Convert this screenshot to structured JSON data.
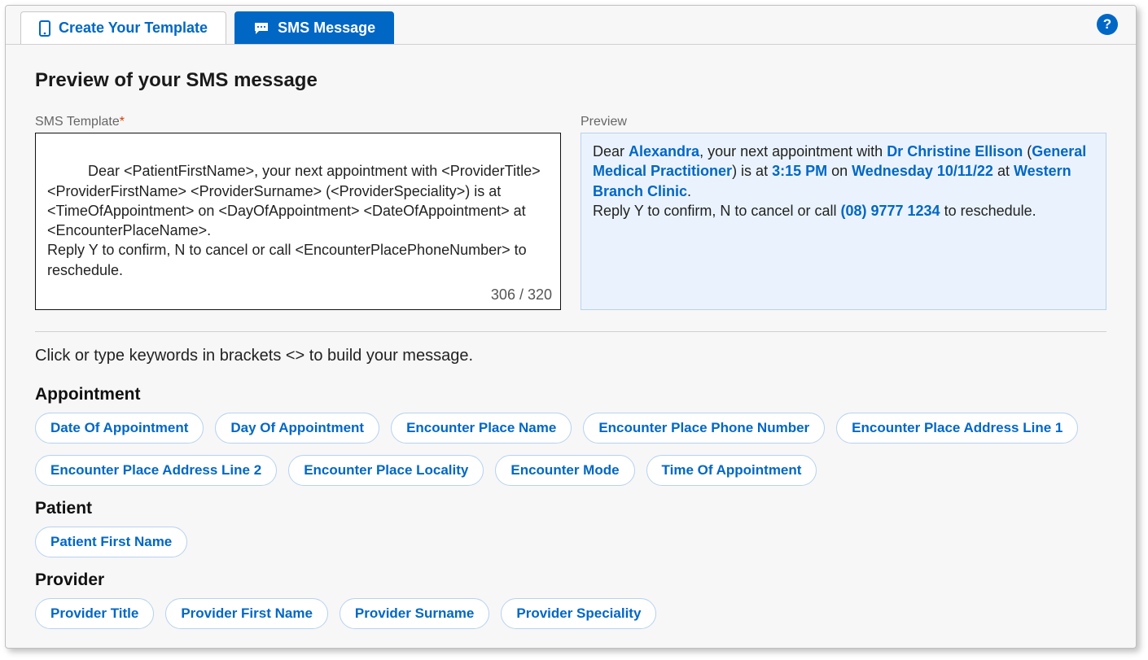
{
  "tabs": {
    "createTemplate": "Create Your Template",
    "smsMessage": "SMS Message"
  },
  "helpGlyph": "?",
  "pageTitle": "Preview of your SMS message",
  "templateLabel": "SMS Template",
  "previewLabel": "Preview",
  "requiredMark": "*",
  "templateText": "Dear <PatientFirstName>, your next appointment with <ProviderTitle> <ProviderFirstName> <ProviderSurname> (<ProviderSpeciality>) is at <TimeOfAppointment> on <DayOfAppointment> <DateOfAppointment> at <EncounterPlaceName>.\nReply Y to confirm, N to cancel or call <EncounterPlacePhoneNumber> to reschedule.",
  "charCount": "306 / 320",
  "preview": {
    "p1_a": "Dear ",
    "patientFirst": "Alexandra",
    "p1_b": ", your next appointment with ",
    "provider": "Dr Christine Ellison",
    "p1_c": " (",
    "speciality": "General Medical Practitioner",
    "p1_d": ") is at ",
    "time": "3:15 PM",
    "p1_e": " on ",
    "day": "Wednesday",
    "space": " ",
    "date": "10/11/22",
    "p1_f": " at ",
    "place": "Western Branch Clinic",
    "p1_g": ".",
    "p2_a": "Reply Y to confirm, N to cancel or call ",
    "phone": "(08) 9777 1234",
    "p2_b": " to reschedule."
  },
  "instruction": "Click or type keywords in brackets <> to build your message.",
  "sections": {
    "appointment": {
      "title": "Appointment",
      "items": [
        "Date Of Appointment",
        "Day Of Appointment",
        "Encounter Place Name",
        "Encounter Place Phone Number",
        "Encounter Place Address Line 1",
        "Encounter Place Address Line 2",
        "Encounter Place Locality",
        "Encounter Mode",
        "Time Of Appointment"
      ]
    },
    "patient": {
      "title": "Patient",
      "items": [
        "Patient First Name"
      ]
    },
    "provider": {
      "title": "Provider",
      "items": [
        "Provider Title",
        "Provider First Name",
        "Provider Surname",
        "Provider Speciality"
      ]
    }
  }
}
